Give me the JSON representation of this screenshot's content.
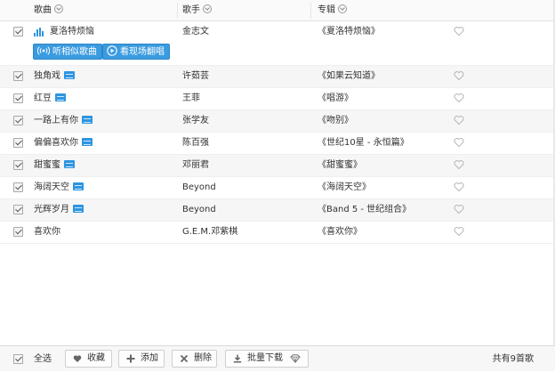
{
  "header": {
    "col_song": "歌曲",
    "col_artist": "歌手",
    "col_album": "专辑"
  },
  "tracks": [
    {
      "title": "夏洛特烦恼",
      "artist": "金志文",
      "album": "《夏洛特烦恼》",
      "mv": false,
      "playing": true
    },
    {
      "title": "独角戏",
      "artist": "许茹芸",
      "album": "《如果云知道》",
      "mv": true,
      "playing": false
    },
    {
      "title": "红豆",
      "artist": "王菲",
      "album": "《唱游》",
      "mv": true,
      "playing": false
    },
    {
      "title": "一路上有你",
      "artist": "张学友",
      "album": "《吻别》",
      "mv": true,
      "playing": false
    },
    {
      "title": "偏偏喜欢你",
      "artist": "陈百强",
      "album": "《世纪10星 - 永恒篇》",
      "mv": true,
      "playing": false
    },
    {
      "title": "甜蜜蜜",
      "artist": "邓丽君",
      "album": "《甜蜜蜜》",
      "mv": true,
      "playing": false
    },
    {
      "title": "海阔天空",
      "artist": "Beyond",
      "album": "《海阔天空》",
      "mv": true,
      "playing": false
    },
    {
      "title": "光辉岁月",
      "artist": "Beyond",
      "album": "《Band 5 - 世纪组合》",
      "mv": true,
      "playing": false
    },
    {
      "title": "喜欢你",
      "artist": "G.E.M.邓紫棋",
      "album": "《喜欢你》",
      "mv": false,
      "playing": false
    }
  ],
  "expanded": {
    "similar_label": "听相似歌曲",
    "live_label": "看现场翻唱"
  },
  "footer": {
    "select_all": "全选",
    "collect": "收藏",
    "add": "添加",
    "delete": "删除",
    "batch_download": "批量下载",
    "count": "共有9首歌"
  },
  "colors": {
    "accent": "#2e95e0",
    "row_alt": "#f6f6f6"
  }
}
